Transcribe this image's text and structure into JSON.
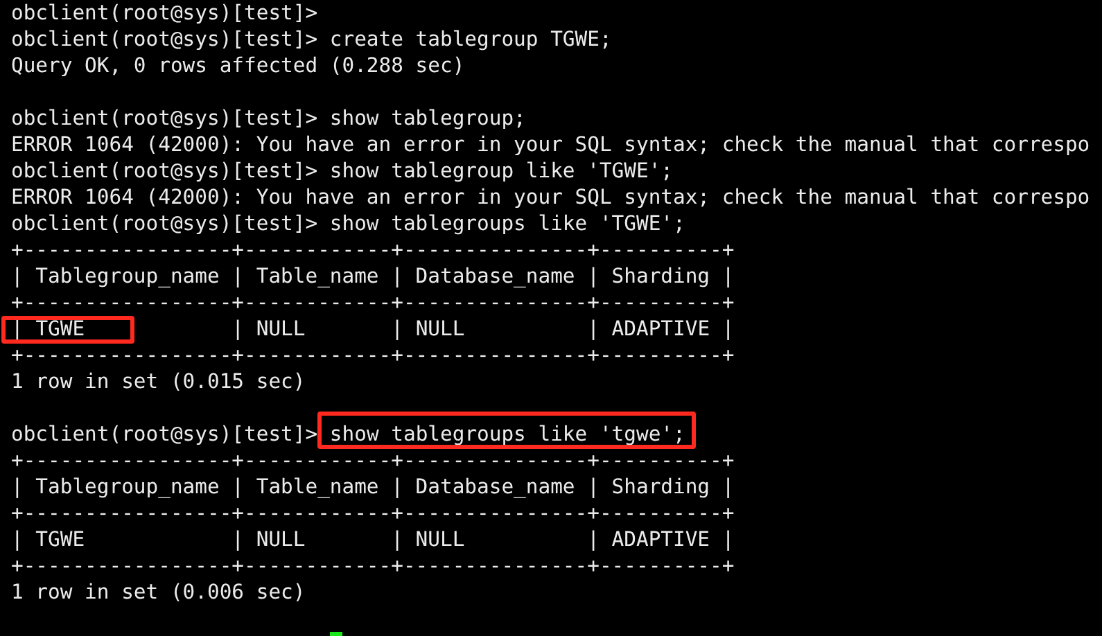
{
  "terminal": {
    "lines": [
      {
        "kind": "command",
        "parts": [
          {
            "text": "obclient(root@sys)[test]>",
            "boxed": false
          }
        ]
      },
      {
        "kind": "command",
        "parts": [
          {
            "text": "obclient(root@sys)[test]> create tablegroup TGWE;",
            "boxed": false
          }
        ]
      },
      {
        "kind": "output",
        "parts": [
          {
            "text": "Query OK, 0 rows affected (0.288 sec)",
            "boxed": false
          }
        ]
      },
      {
        "kind": "blank"
      },
      {
        "kind": "command",
        "parts": [
          {
            "text": "obclient(root@sys)[test]> show tablegroup;",
            "boxed": false
          }
        ]
      },
      {
        "kind": "error",
        "parts": [
          {
            "text": "ERROR 1064 (42000): You have an error in your SQL syntax; check the manual that correspo",
            "boxed": false
          }
        ]
      },
      {
        "kind": "command",
        "parts": [
          {
            "text": "obclient(root@sys)[test]> show tablegroup like 'TGWE';",
            "boxed": false
          }
        ]
      },
      {
        "kind": "error",
        "parts": [
          {
            "text": "ERROR 1064 (42000): You have an error in your SQL syntax; check the manual that correspo",
            "boxed": false
          }
        ]
      },
      {
        "kind": "command",
        "parts": [
          {
            "text": "obclient(root@sys)[test]> show tablegroups like 'TGWE';",
            "boxed": false
          }
        ]
      },
      {
        "kind": "border",
        "parts": [
          {
            "text": "+-----------------+------------+---------------+----------+",
            "boxed": false
          }
        ]
      },
      {
        "kind": "row",
        "parts": [
          {
            "text": "| Tablegroup_name | Table_name | Database_name | Sharding |",
            "boxed": false
          }
        ]
      },
      {
        "kind": "border",
        "parts": [
          {
            "text": "+-----------------+------------+---------------+----------+",
            "boxed": false
          }
        ]
      },
      {
        "kind": "row",
        "parts": [
          {
            "text": "| ",
            "boxed": false
          },
          {
            "text": "TGWE",
            "boxed": true
          },
          {
            "text": "            | NULL       | NULL          | ADAPTIVE |",
            "boxed": false
          }
        ]
      },
      {
        "kind": "border",
        "parts": [
          {
            "text": "+-----------------+------------+---------------+----------+",
            "boxed": false
          }
        ]
      },
      {
        "kind": "output",
        "parts": [
          {
            "text": "1 row in set (0.015 sec)",
            "boxed": false
          }
        ]
      },
      {
        "kind": "blank"
      },
      {
        "kind": "command",
        "parts": [
          {
            "text": "obclient(root@sys)[test]> ",
            "boxed": false
          },
          {
            "text": "show tablegroups like 'tgwe';",
            "boxed": true
          }
        ]
      },
      {
        "kind": "border",
        "parts": [
          {
            "text": "+-----------------+------------+---------------+----------+",
            "boxed": false
          }
        ]
      },
      {
        "kind": "row",
        "parts": [
          {
            "text": "| Tablegroup_name | Table_name | Database_name | Sharding |",
            "boxed": false
          }
        ]
      },
      {
        "kind": "border",
        "parts": [
          {
            "text": "+-----------------+------------+---------------+----------+",
            "boxed": false
          }
        ]
      },
      {
        "kind": "row",
        "parts": [
          {
            "text": "| TGWE            | NULL       | NULL          | ADAPTIVE |",
            "boxed": false
          }
        ]
      },
      {
        "kind": "border",
        "parts": [
          {
            "text": "+-----------------+------------+---------------+----------+",
            "boxed": false
          }
        ]
      },
      {
        "kind": "output",
        "parts": [
          {
            "text": "1 row in set (0.006 sec)",
            "boxed": false
          }
        ]
      },
      {
        "kind": "blank"
      }
    ],
    "cursor": {
      "visible": true
    }
  }
}
